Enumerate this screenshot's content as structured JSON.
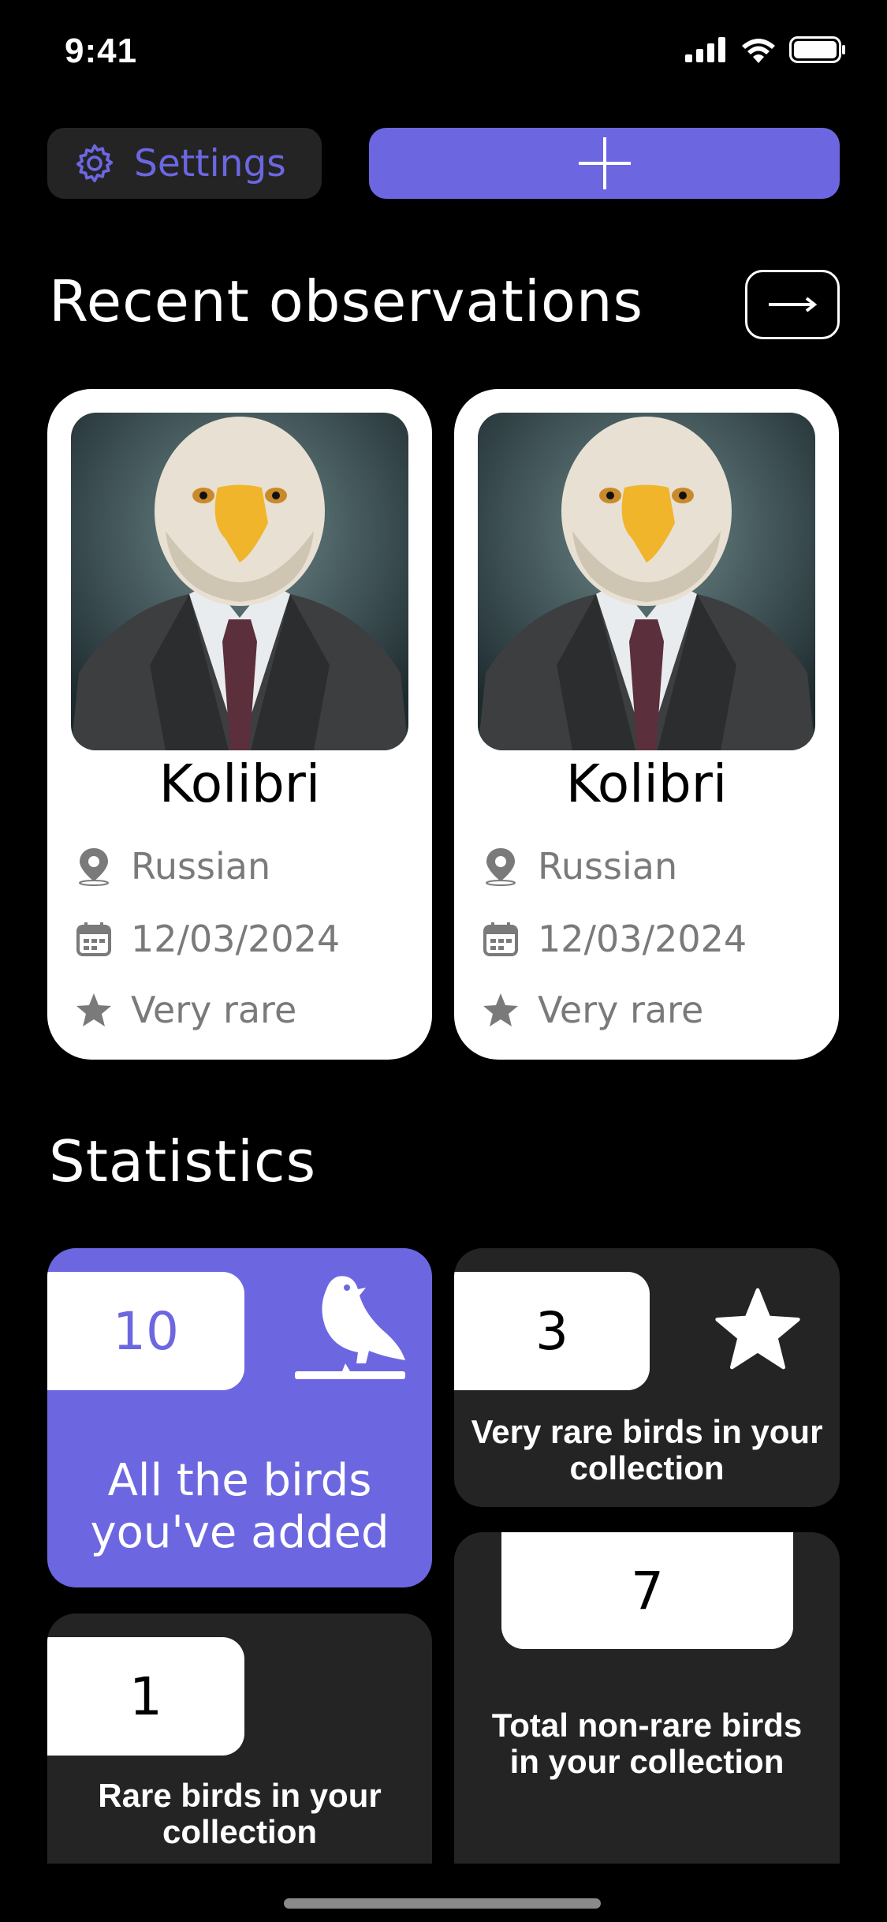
{
  "status_bar": {
    "time": "9:41"
  },
  "header": {
    "settings_label": "Settings",
    "add_icon": "plus-icon"
  },
  "recent": {
    "title": "Recent observations",
    "more_icon": "arrow-right-icon",
    "cards": [
      {
        "name": "Kolibri",
        "location": "Russian",
        "date": "12/03/2024",
        "rarity": "Very rare",
        "photo": "eagle-in-suit"
      },
      {
        "name": "Kolibri",
        "location": "Russian",
        "date": "12/03/2024",
        "rarity": "Very rare",
        "photo": "eagle-in-suit"
      }
    ]
  },
  "statistics": {
    "title": "Statistics",
    "all": {
      "value": "10",
      "label": "All the birds you've added",
      "icon": "bird-icon"
    },
    "very_rare": {
      "value": "3",
      "label": "Very rare birds in your collection",
      "icon": "star-icon"
    },
    "rare": {
      "value": "1",
      "label": "Rare birds in your collection"
    },
    "non_rare": {
      "value": "7",
      "label": "Total non-rare birds in your collection"
    }
  },
  "colors": {
    "accent": "#6c67e1",
    "card_dark": "#242424",
    "background": "#000000"
  }
}
